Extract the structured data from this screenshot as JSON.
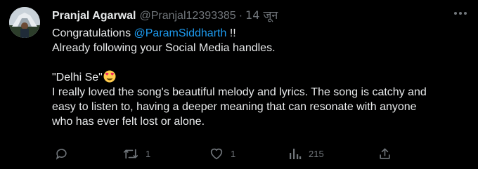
{
  "tweet": {
    "author_name": "Pranjal Agarwal",
    "handle": "@Pranjal12393385",
    "separator": "·",
    "date": "14 जून",
    "lines": {
      "congrats_prefix": "Congratulations ",
      "mention": "@ParamSiddharth",
      "congrats_suffix": " !!",
      "following": "Already following your Social Media handles.",
      "song_title": "\"Delhi Se\"",
      "review_1": "I really loved the song's beautiful melody and lyrics. The song is catchy and",
      "review_2": "easy to listen to, having a deeper meaning that can resonate with anyone",
      "review_3": "who has ever felt lost or alone."
    },
    "emoji": "heart-eyes-emoji",
    "actions": {
      "reply_count": "",
      "retweet_count": "1",
      "like_count": "1",
      "views_count": "215"
    }
  },
  "colors": {
    "background": "#000000",
    "text": "#e7e9ea",
    "muted": "#71767b",
    "link": "#1d9bf0",
    "emoji": "#ffcc4d"
  },
  "icons": [
    "more-icon",
    "reply-icon",
    "retweet-icon",
    "like-icon",
    "views-icon",
    "share-icon"
  ]
}
